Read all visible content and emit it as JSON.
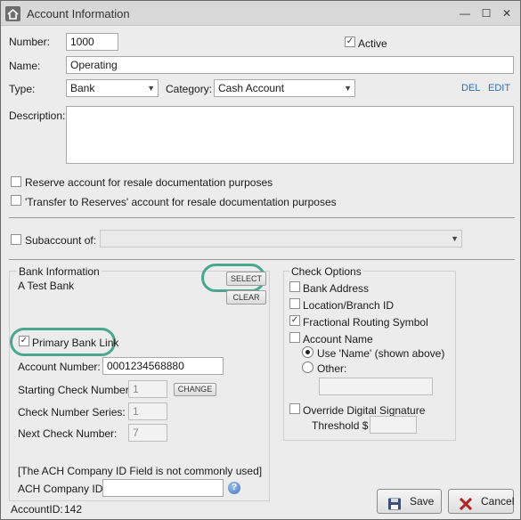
{
  "window": {
    "title": "Account Information",
    "minimize": "—",
    "maximize": "☐",
    "close": "✕"
  },
  "form": {
    "number_label": "Number:",
    "number_value": "1000",
    "active_label": "Active",
    "name_label": "Name:",
    "name_value": "Operating",
    "type_label": "Type:",
    "type_value": "Bank",
    "category_label": "Category:",
    "category_value": "Cash Account",
    "del_link": "DEL",
    "edit_link": "EDIT",
    "description_label": "Description:",
    "reserve_label": "Reserve account for resale documentation purposes",
    "transfer_label": "'Transfer to Reserves' account for resale documentation purposes",
    "subaccount_label": "Subaccount of:"
  },
  "bank": {
    "section_label": "Bank Information",
    "bank_name": "A Test Bank",
    "select_button": "SELECT",
    "clear_button": "CLEAR",
    "primary_label": "Primary Bank Link",
    "account_number_label": "Account Number:",
    "account_number_value": "0001234568880",
    "starting_check_label": "Starting Check Number:",
    "starting_check_value": "1",
    "change_button": "CHANGE",
    "series_label": "Check Number Series:",
    "series_value": "1",
    "next_check_label": "Next Check Number:",
    "next_check_value": "7",
    "ach_note": "[The ACH Company ID Field is not commonly used]",
    "ach_label": "ACH Company ID:"
  },
  "check_options": {
    "section_label": "Check Options",
    "bank_address": "Bank Address",
    "location_branch": "Location/Branch ID",
    "fractional_routing": "Fractional Routing Symbol",
    "account_name": "Account Name",
    "use_name": "Use 'Name' (shown above)",
    "other": "Other:",
    "override_signature": "Override Digital Signature",
    "threshold": "Threshold $"
  },
  "footer": {
    "account_id_label": "AccountID:",
    "account_id_value": "142",
    "save_button": "Save",
    "cancel_button": "Cancel"
  }
}
